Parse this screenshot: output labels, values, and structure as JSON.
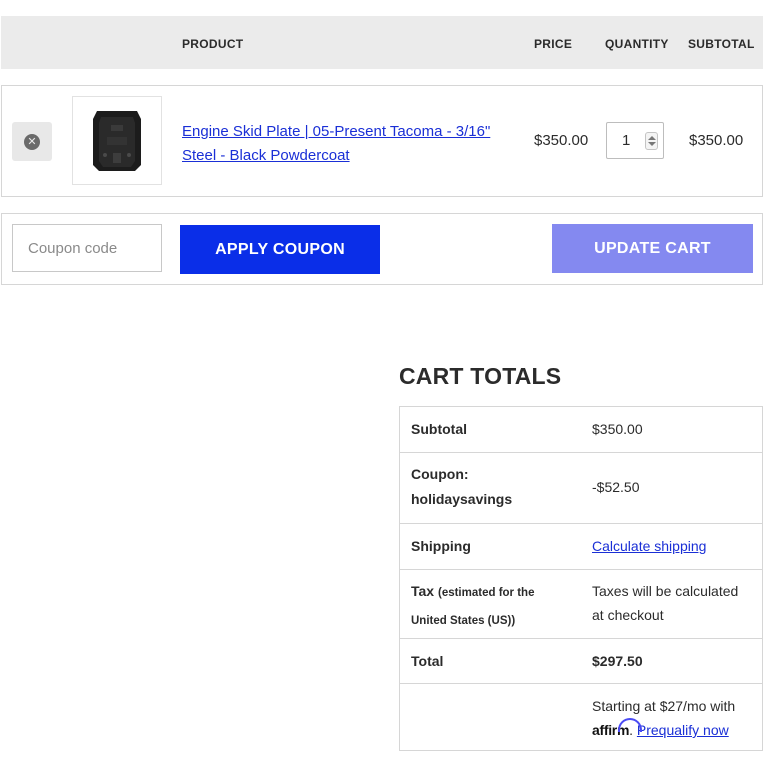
{
  "header": {
    "product": "PRODUCT",
    "price": "PRICE",
    "quantity": "QUANTITY",
    "subtotal": "SUBTOTAL"
  },
  "item": {
    "name": "Engine Skid Plate | 05-Present Tacoma - 3/16\" Steel - Black Powdercoat",
    "price": "$350.00",
    "quantity": "1",
    "subtotal": "$350.00",
    "remove_icon": "close-circle-icon",
    "image_icon": "skid-plate-thumbnail"
  },
  "coupon": {
    "placeholder": "Coupon code",
    "apply_label": "APPLY COUPON",
    "update_label": "UPDATE CART"
  },
  "totals": {
    "title": "CART TOTALS",
    "subtotal_label": "Subtotal",
    "subtotal_value": "$350.00",
    "coupon_label_line1": "Coupon:",
    "coupon_label_line2": "holidaysavings",
    "coupon_value": "-$52.50",
    "shipping_label": "Shipping",
    "shipping_value": "Calculate shipping",
    "tax_label": "Tax",
    "tax_note_line1": "(estimated for the",
    "tax_note_line2": "United States (US))",
    "tax_value_line1": "Taxes will be calculated",
    "tax_value_line2": "at checkout",
    "total_label": "Total",
    "total_value": "$297.50",
    "affirm_line1": "Starting at $27/mo with",
    "affirm_brand": "affirm",
    "affirm_link": "Prequalify now"
  },
  "colors": {
    "apply_button": "#0a2ee8",
    "update_button": "#8489f0",
    "link": "#1a2fd6",
    "header_bg": "#ebebeb"
  }
}
